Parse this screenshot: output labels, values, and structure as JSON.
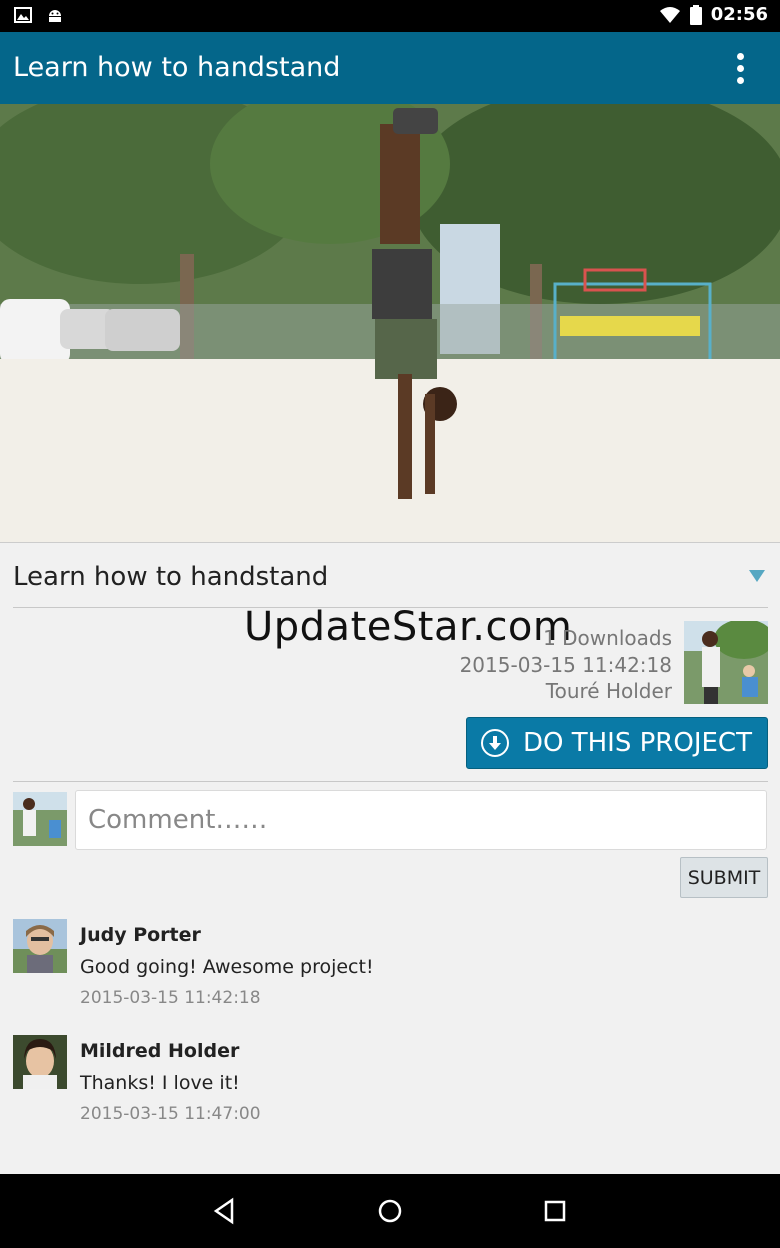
{
  "statusbar": {
    "clock": "02:56"
  },
  "appbar": {
    "title": "Learn how to handstand",
    "menu_icon": "overflow-menu-icon"
  },
  "project": {
    "title": "Learn how to handstand",
    "downloads": "1 Downloads",
    "date": "2015-03-15 11:42:18",
    "owner": "Touré Holder",
    "do_button_label": "DO THIS PROJECT"
  },
  "watermark": "UpdateStar.com",
  "comment_form": {
    "placeholder": "Comment……",
    "submit_label": "SUBMIT"
  },
  "comments": [
    {
      "name": "Judy Porter",
      "text": "Good going! Awesome project!",
      "time": "2015-03-15 11:42:18"
    },
    {
      "name": "Mildred Holder",
      "text": "Thanks! I love it!",
      "time": "2015-03-15 11:47:00"
    }
  ],
  "colors": {
    "appbar": "#04668a",
    "button": "#0a7aa6",
    "arrow": "#56a7c2"
  }
}
